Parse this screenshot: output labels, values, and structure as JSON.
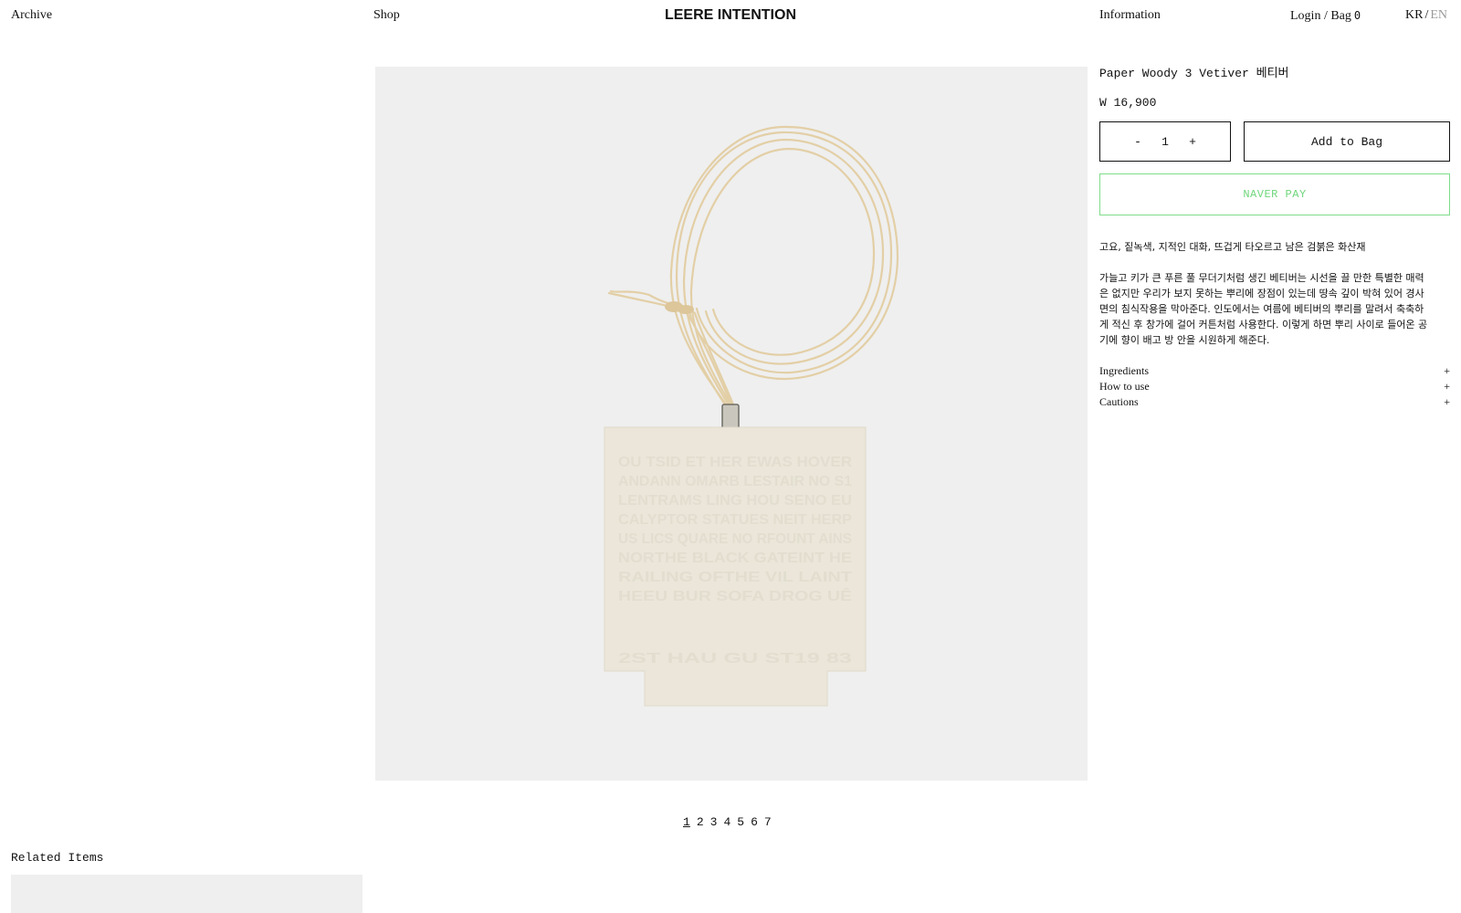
{
  "header": {
    "archive": "Archive",
    "shop": "Shop",
    "brand": "LEERE INTENTION",
    "information": "Information",
    "login": "Login",
    "separator": "/",
    "bag": "Bag",
    "bag_count": "0",
    "lang_kr": "KR",
    "lang_sep": "/",
    "lang_en": "EN"
  },
  "product": {
    "title": "Paper Woody 3 Vetiver 베티버",
    "price": "W 16,900",
    "quantity": {
      "minus": "-",
      "value": "1",
      "plus": "+"
    },
    "add_to_bag": "Add to Bag",
    "naver_pay": "NAVER PAY",
    "tagline": "고요, 짙녹색, 지적인 대화, 뜨겁게 타오르고 남은 검붉은 화산재",
    "description_lines": [
      "가늘고 키가 큰 푸른 풀 무더기처럼 생긴 베티버는 시선을 끌 만한 특별한 매력",
      "은 없지만 우리가 보지 못하는 뿌리에 장점이 있는데 땅속 깊이 박혀 있어 경사",
      "면의 침식작용을 막아준다. 인도에서는 여름에 베티버의 뿌리를 말려서 축축하",
      "게 적신 후 창가에 걸어 커튼처럼 사용한다. 이렇게 하면 뿌리 사이로 들어온 공",
      "기에 향이 배고 방 안을 시원하게 해준다."
    ],
    "accordions": [
      {
        "label": "Ingredients",
        "toggle": "+"
      },
      {
        "label": "How to use",
        "toggle": "+"
      },
      {
        "label": "Cautions",
        "toggle": "+"
      }
    ],
    "image_embossed_text": [
      "OU TSID ET HER EWAS HOVER",
      "ANDANN OMARB LESTAIR NO S1",
      "LENTRAMS LING HOU SENO EU",
      "CALYPTOR STATUES NEIT HERP",
      "US LICS QUARE NO RFOUNT AINS",
      "NORTHE BLACK GATEINT HE",
      "RAILING OFTHE VIL LAINT",
      "HEEU BUR SOFA DROG UÊ",
      "2ST HAU GU ST19 83"
    ]
  },
  "gallery": {
    "pages": [
      "1",
      "2",
      "3",
      "4",
      "5",
      "6",
      "7"
    ],
    "active_index": 0
  },
  "related": {
    "title": "Related Items"
  },
  "colors": {
    "text": "#111111",
    "muted": "#9a9a9a",
    "image_bg": "#efefef",
    "naver_green": "#6fd67b",
    "tag_color": "#ebe6d9",
    "cord_color": "#e5d2ac"
  }
}
